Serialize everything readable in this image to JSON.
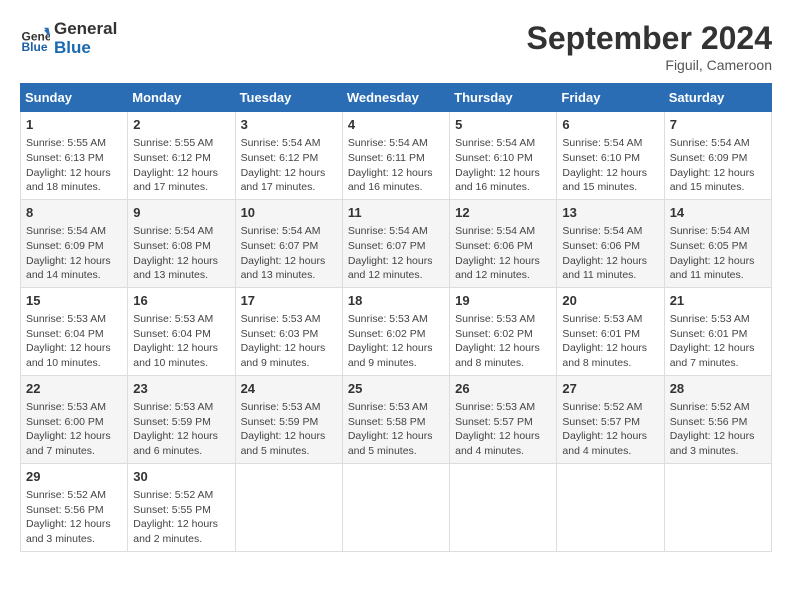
{
  "logo": {
    "line1": "General",
    "line2": "Blue"
  },
  "title": "September 2024",
  "location": "Figuil, Cameroon",
  "days_header": [
    "Sunday",
    "Monday",
    "Tuesday",
    "Wednesday",
    "Thursday",
    "Friday",
    "Saturday"
  ],
  "weeks": [
    [
      {
        "day": "1",
        "detail": "Sunrise: 5:55 AM\nSunset: 6:13 PM\nDaylight: 12 hours\nand 18 minutes."
      },
      {
        "day": "2",
        "detail": "Sunrise: 5:55 AM\nSunset: 6:12 PM\nDaylight: 12 hours\nand 17 minutes."
      },
      {
        "day": "3",
        "detail": "Sunrise: 5:54 AM\nSunset: 6:12 PM\nDaylight: 12 hours\nand 17 minutes."
      },
      {
        "day": "4",
        "detail": "Sunrise: 5:54 AM\nSunset: 6:11 PM\nDaylight: 12 hours\nand 16 minutes."
      },
      {
        "day": "5",
        "detail": "Sunrise: 5:54 AM\nSunset: 6:10 PM\nDaylight: 12 hours\nand 16 minutes."
      },
      {
        "day": "6",
        "detail": "Sunrise: 5:54 AM\nSunset: 6:10 PM\nDaylight: 12 hours\nand 15 minutes."
      },
      {
        "day": "7",
        "detail": "Sunrise: 5:54 AM\nSunset: 6:09 PM\nDaylight: 12 hours\nand 15 minutes."
      }
    ],
    [
      {
        "day": "8",
        "detail": "Sunrise: 5:54 AM\nSunset: 6:09 PM\nDaylight: 12 hours\nand 14 minutes."
      },
      {
        "day": "9",
        "detail": "Sunrise: 5:54 AM\nSunset: 6:08 PM\nDaylight: 12 hours\nand 13 minutes."
      },
      {
        "day": "10",
        "detail": "Sunrise: 5:54 AM\nSunset: 6:07 PM\nDaylight: 12 hours\nand 13 minutes."
      },
      {
        "day": "11",
        "detail": "Sunrise: 5:54 AM\nSunset: 6:07 PM\nDaylight: 12 hours\nand 12 minutes."
      },
      {
        "day": "12",
        "detail": "Sunrise: 5:54 AM\nSunset: 6:06 PM\nDaylight: 12 hours\nand 12 minutes."
      },
      {
        "day": "13",
        "detail": "Sunrise: 5:54 AM\nSunset: 6:06 PM\nDaylight: 12 hours\nand 11 minutes."
      },
      {
        "day": "14",
        "detail": "Sunrise: 5:54 AM\nSunset: 6:05 PM\nDaylight: 12 hours\nand 11 minutes."
      }
    ],
    [
      {
        "day": "15",
        "detail": "Sunrise: 5:53 AM\nSunset: 6:04 PM\nDaylight: 12 hours\nand 10 minutes."
      },
      {
        "day": "16",
        "detail": "Sunrise: 5:53 AM\nSunset: 6:04 PM\nDaylight: 12 hours\nand 10 minutes."
      },
      {
        "day": "17",
        "detail": "Sunrise: 5:53 AM\nSunset: 6:03 PM\nDaylight: 12 hours\nand 9 minutes."
      },
      {
        "day": "18",
        "detail": "Sunrise: 5:53 AM\nSunset: 6:02 PM\nDaylight: 12 hours\nand 9 minutes."
      },
      {
        "day": "19",
        "detail": "Sunrise: 5:53 AM\nSunset: 6:02 PM\nDaylight: 12 hours\nand 8 minutes."
      },
      {
        "day": "20",
        "detail": "Sunrise: 5:53 AM\nSunset: 6:01 PM\nDaylight: 12 hours\nand 8 minutes."
      },
      {
        "day": "21",
        "detail": "Sunrise: 5:53 AM\nSunset: 6:01 PM\nDaylight: 12 hours\nand 7 minutes."
      }
    ],
    [
      {
        "day": "22",
        "detail": "Sunrise: 5:53 AM\nSunset: 6:00 PM\nDaylight: 12 hours\nand 7 minutes."
      },
      {
        "day": "23",
        "detail": "Sunrise: 5:53 AM\nSunset: 5:59 PM\nDaylight: 12 hours\nand 6 minutes."
      },
      {
        "day": "24",
        "detail": "Sunrise: 5:53 AM\nSunset: 5:59 PM\nDaylight: 12 hours\nand 5 minutes."
      },
      {
        "day": "25",
        "detail": "Sunrise: 5:53 AM\nSunset: 5:58 PM\nDaylight: 12 hours\nand 5 minutes."
      },
      {
        "day": "26",
        "detail": "Sunrise: 5:53 AM\nSunset: 5:57 PM\nDaylight: 12 hours\nand 4 minutes."
      },
      {
        "day": "27",
        "detail": "Sunrise: 5:52 AM\nSunset: 5:57 PM\nDaylight: 12 hours\nand 4 minutes."
      },
      {
        "day": "28",
        "detail": "Sunrise: 5:52 AM\nSunset: 5:56 PM\nDaylight: 12 hours\nand 3 minutes."
      }
    ],
    [
      {
        "day": "29",
        "detail": "Sunrise: 5:52 AM\nSunset: 5:56 PM\nDaylight: 12 hours\nand 3 minutes."
      },
      {
        "day": "30",
        "detail": "Sunrise: 5:52 AM\nSunset: 5:55 PM\nDaylight: 12 hours\nand 2 minutes."
      },
      {
        "day": "",
        "detail": ""
      },
      {
        "day": "",
        "detail": ""
      },
      {
        "day": "",
        "detail": ""
      },
      {
        "day": "",
        "detail": ""
      },
      {
        "day": "",
        "detail": ""
      }
    ]
  ]
}
